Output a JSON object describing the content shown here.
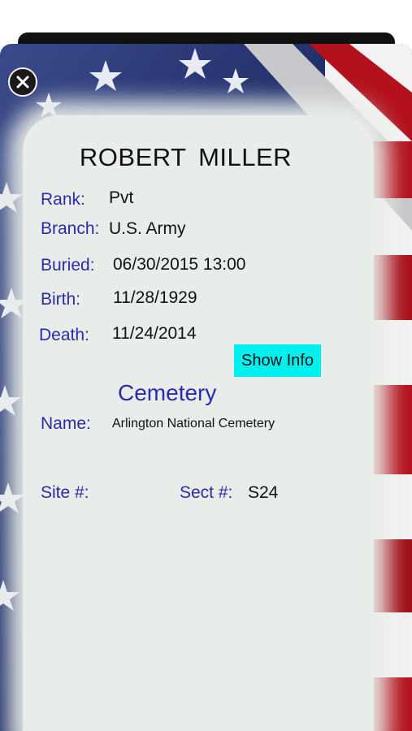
{
  "person": {
    "name": "ROBERT  MILLER"
  },
  "fields": {
    "rank": {
      "label": "Rank:",
      "value": "Pvt"
    },
    "branch": {
      "label": "Branch:",
      "value": "U.S. Army"
    },
    "buried": {
      "label": "Buried:",
      "value": "06/30/2015 13:00"
    },
    "birth": {
      "label": "Birth:",
      "value": "11/28/1929"
    },
    "death": {
      "label": "Death:",
      "value": "11/24/2014"
    }
  },
  "show_info_label": "Show Info",
  "cemetery": {
    "heading": "Cemetery",
    "name_label": "Name:",
    "name_value": "Arlington National Cemetery",
    "site_label": "Site #:",
    "site_value": "",
    "sect_label": "Sect #:",
    "sect_value": "S24"
  },
  "icons": {
    "close": "close-icon"
  },
  "colors": {
    "label_blue": "#2b2ba6",
    "button_cyan": "#00f0f0",
    "panel": "#e9ede9",
    "flag_red": "#b3121d",
    "flag_blue": "#1c2a63"
  }
}
